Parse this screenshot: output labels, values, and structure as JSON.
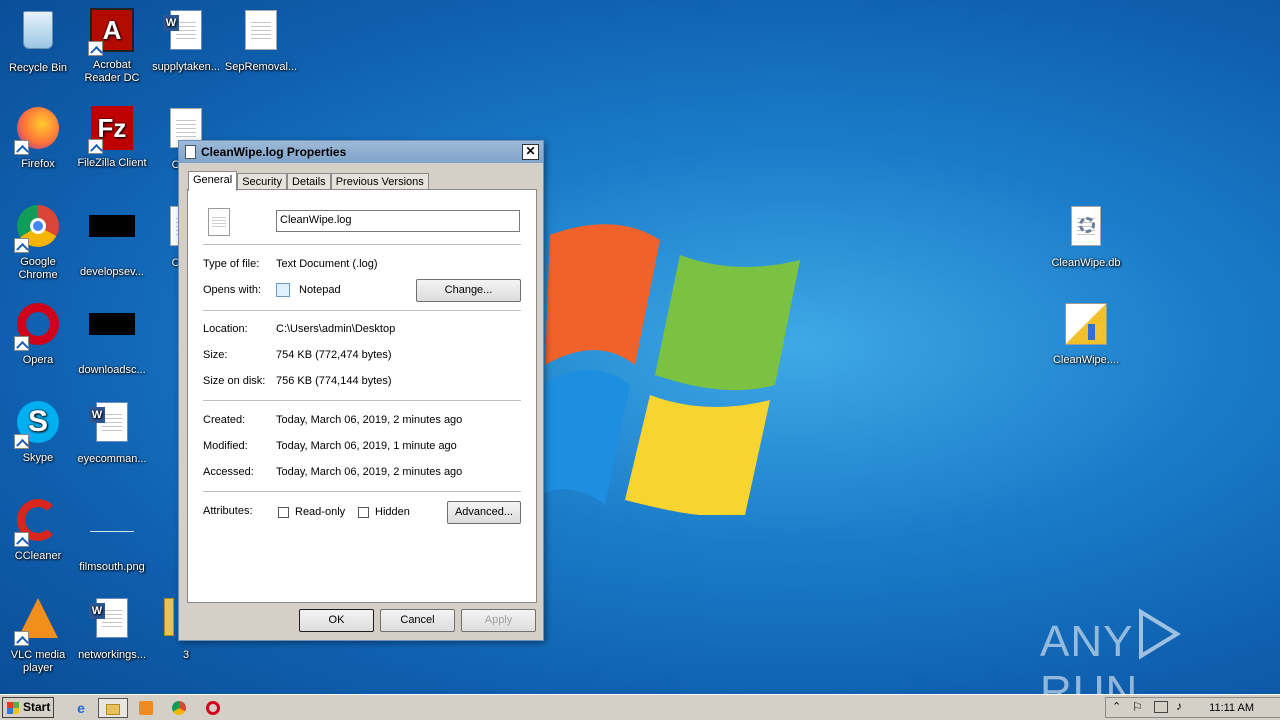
{
  "desktop": {
    "icons": [
      {
        "label": "Recycle Bin",
        "icon": "recycle-bin-icon"
      },
      {
        "label": "Acrobat Reader DC",
        "icon": "acrobat-icon"
      },
      {
        "label": "supplytaken...",
        "icon": "word-doc-icon"
      },
      {
        "label": "SepRemoval...",
        "icon": "text-doc-icon"
      },
      {
        "label": "Firefox",
        "icon": "firefox-icon"
      },
      {
        "label": "FileZilla Client",
        "icon": "filezilla-icon"
      },
      {
        "label": "Clean",
        "icon": "text-doc-icon"
      },
      {
        "label": "Google Chrome",
        "icon": "chrome-icon"
      },
      {
        "label": "developsev...",
        "icon": "black-image-icon"
      },
      {
        "label": "Clean",
        "icon": "text-doc-icon"
      },
      {
        "label": "Opera",
        "icon": "opera-icon"
      },
      {
        "label": "downloadsc...",
        "icon": "black-image-icon"
      },
      {
        "label": "Skype",
        "icon": "skype-icon"
      },
      {
        "label": "eyecomman...",
        "icon": "word-doc-icon"
      },
      {
        "label": "CCleaner",
        "icon": "ccleaner-icon"
      },
      {
        "label": "filmsouth.png",
        "icon": "image-icon"
      },
      {
        "label": "VLC media player",
        "icon": "vlc-icon"
      },
      {
        "label": "networkings...",
        "icon": "word-doc-icon"
      },
      {
        "label": "3",
        "icon": "folder-icon"
      },
      {
        "label": "CleanWipe.db",
        "icon": "db-file-icon"
      },
      {
        "label": "CleanWipe....",
        "icon": "installer-icon"
      }
    ],
    "watermark": {
      "left": "ANY",
      "right": "RUN"
    }
  },
  "dialog": {
    "title": "CleanWipe.log Properties",
    "tabs": [
      "General",
      "Security",
      "Details",
      "Previous Versions"
    ],
    "filename": "CleanWipe.log",
    "labels": {
      "type": "Type of file:",
      "opens": "Opens with:",
      "location": "Location:",
      "size": "Size:",
      "size_on_disk": "Size on disk:",
      "created": "Created:",
      "modified": "Modified:",
      "accessed": "Accessed:",
      "attributes": "Attributes:"
    },
    "values": {
      "type": "Text Document (.log)",
      "opens": "Notepad",
      "location": "C:\\Users\\admin\\Desktop",
      "size": "754 KB (772,474 bytes)",
      "size_on_disk": "756 KB (774,144 bytes)",
      "created": "Today, March 06, 2019, 2 minutes ago",
      "modified": "Today, March 06, 2019, 1 minute ago",
      "accessed": "Today, March 06, 2019, 2 minutes ago"
    },
    "change_button": "Change...",
    "readonly_label": "Read-only",
    "hidden_label": "Hidden",
    "advanced_button": "Advanced...",
    "ok_button": "OK",
    "cancel_button": "Cancel",
    "apply_button": "Apply",
    "close_glyph": "✕"
  },
  "taskbar": {
    "start_label": "Start",
    "clock": "11:11 AM"
  }
}
